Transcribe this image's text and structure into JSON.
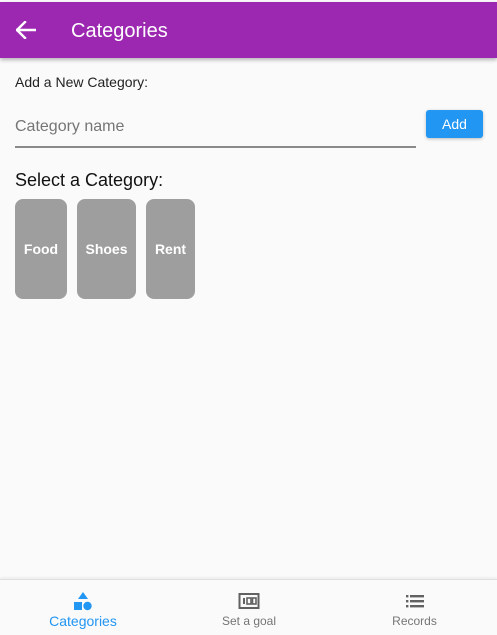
{
  "appbar": {
    "title": "Categories",
    "back_icon": "arrow-back-icon",
    "color": "#9c27b0"
  },
  "add_section": {
    "label": "Add a New Category:",
    "input_placeholder": "Category name",
    "input_value": "",
    "add_button_label": "Add",
    "button_color": "#2196f3"
  },
  "select_section": {
    "title": "Select a Category:",
    "categories": [
      {
        "label": "Food"
      },
      {
        "label": "Shoes"
      },
      {
        "label": "Rent"
      }
    ],
    "chip_color": "#9e9e9e"
  },
  "bottom_nav": {
    "items": [
      {
        "label": "Categories",
        "icon": "category-shapes-icon",
        "active": true
      },
      {
        "label": "Set a goal",
        "icon": "goal-counter-icon",
        "active": false
      },
      {
        "label": "Records",
        "icon": "list-icon",
        "active": false
      }
    ],
    "active_color": "#2196f3",
    "inactive_color": "#757575"
  }
}
